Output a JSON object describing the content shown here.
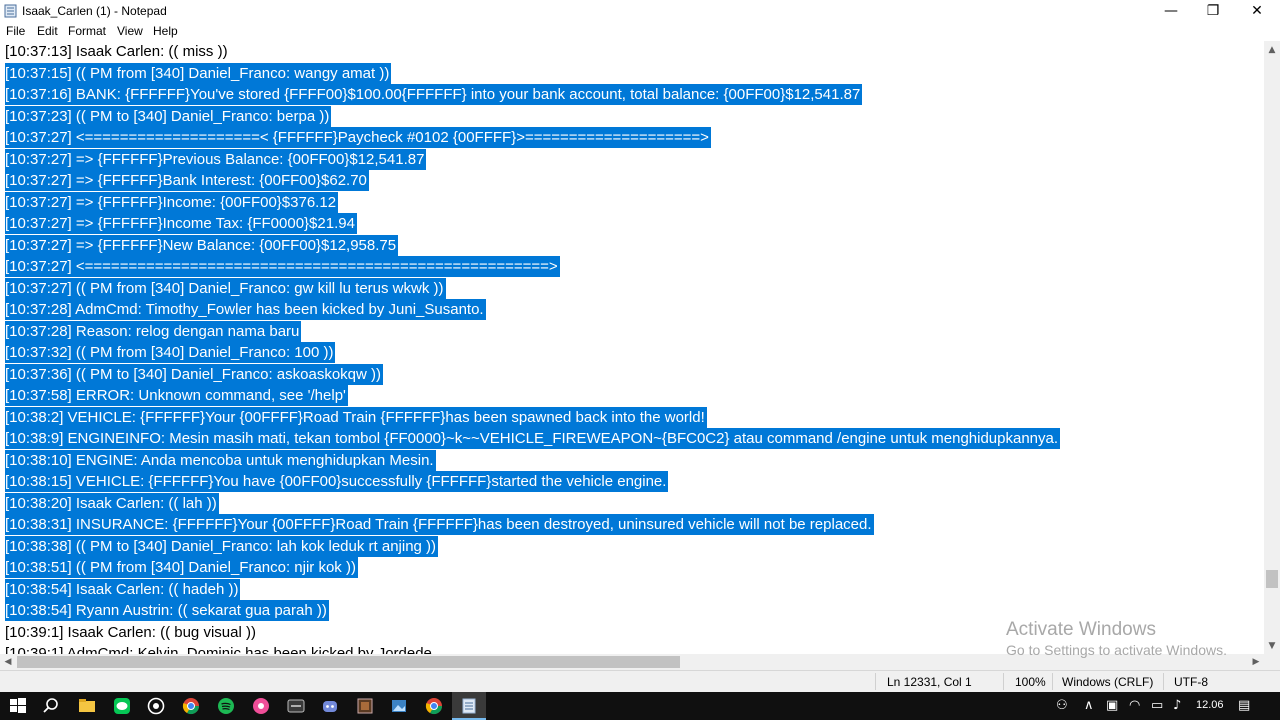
{
  "window": {
    "title": "Isaak_Carlen (1) - Notepad",
    "minimize_glyph": "—",
    "restore_glyph": "❐",
    "close_glyph": "✕"
  },
  "menu": [
    "File",
    "Edit",
    "Format",
    "View",
    "Help"
  ],
  "editor": {
    "lines": [
      {
        "text": "[10:37:13] Isaak Carlen: (( miss ))",
        "selected": false
      },
      {
        "text": "[10:37:15] (( PM from [340] Daniel_Franco: wangy amat ))",
        "selected": true
      },
      {
        "text": "[10:37:16] BANK: {FFFFFF}You've stored {FFFF00}$100.00{FFFFFF} into your bank account, total balance: {00FF00}$12,541.87",
        "selected": true
      },
      {
        "text": "[10:37:23] (( PM to [340] Daniel_Franco: berpa ))",
        "selected": true
      },
      {
        "text": "[10:37:27] <====================< {FFFFFF}Paycheck #0102 {00FFFF}>====================>",
        "selected": true
      },
      {
        "text": "[10:37:27] => {FFFFFF}Previous Balance: {00FF00}$12,541.87",
        "selected": true
      },
      {
        "text": "[10:37:27] => {FFFFFF}Bank Interest: {00FF00}$62.70",
        "selected": true
      },
      {
        "text": "[10:37:27] => {FFFFFF}Income: {00FF00}$376.12",
        "selected": true
      },
      {
        "text": "[10:37:27] => {FFFFFF}Income Tax: {FF0000}$21.94",
        "selected": true
      },
      {
        "text": "[10:37:27] => {FFFFFF}New Balance: {00FF00}$12,958.75",
        "selected": true
      },
      {
        "text": "[10:37:27] <=====================================================>",
        "selected": true
      },
      {
        "text": "[10:37:27] (( PM from [340] Daniel_Franco: gw kill lu terus wkwk ))",
        "selected": true
      },
      {
        "text": "[10:37:28] AdmCmd: Timothy_Fowler has been kicked by Juni_Susanto.",
        "selected": true
      },
      {
        "text": "[10:37:28] Reason: relog dengan nama baru",
        "selected": true
      },
      {
        "text": "[10:37:32] (( PM from [340] Daniel_Franco: 100 ))",
        "selected": true
      },
      {
        "text": "[10:37:36] (( PM to [340] Daniel_Franco: askoaskokqw ))",
        "selected": true
      },
      {
        "text": "[10:37:58] ERROR: Unknown command, see '/help'",
        "selected": true
      },
      {
        "text": "[10:38:2] VEHICLE: {FFFFFF}Your {00FFFF}Road Train {FFFFFF}has been spawned back into the world!",
        "selected": true
      },
      {
        "text": "[10:38:9] ENGINEINFO: Mesin masih mati, tekan tombol {FF0000}~k~~VEHICLE_FIREWEAPON~{BFC0C2} atau command /engine untuk menghidupkannya.",
        "selected": true
      },
      {
        "text": "[10:38:10] ENGINE: Anda mencoba untuk menghidupkan Mesin.",
        "selected": true
      },
      {
        "text": "[10:38:15] VEHICLE: {FFFFFF}You have {00FF00}successfully {FFFFFF}started the vehicle engine.",
        "selected": true
      },
      {
        "text": "[10:38:20] Isaak Carlen: (( lah ))",
        "selected": true
      },
      {
        "text": "[10:38:31] INSURANCE: {FFFFFF}Your {00FFFF}Road Train {FFFFFF}has been destroyed, uninsured vehicle will not be replaced.",
        "selected": true
      },
      {
        "text": "[10:38:38] (( PM to [340] Daniel_Franco: lah kok leduk rt anjing ))",
        "selected": true
      },
      {
        "text": "[10:38:51] (( PM from [340] Daniel_Franco: njir kok ))",
        "selected": true
      },
      {
        "text": "[10:38:54] Isaak Carlen: (( hadeh ))",
        "selected": true
      },
      {
        "text": "[10:38:54] Ryann Austrin: (( sekarat gua parah ))",
        "selected": true
      },
      {
        "text": "[10:39:1] Isaak Carlen: (( bug visual  ))",
        "selected": false
      },
      {
        "text": "[10:39:1] AdmCmd: Kelvin_Dominic has been kicked by Jordede",
        "selected": false
      }
    ]
  },
  "statusbar": {
    "position": "Ln 12331, Col 1",
    "zoom": "100%",
    "line_ending": "Windows (CRLF)",
    "encoding": "UTF-8"
  },
  "watermark": {
    "title": "Activate Windows",
    "subtitle": "Go to Settings to activate Windows."
  },
  "taskbar": {
    "clock": "12.06"
  },
  "colors": {
    "selection": "#0078d7",
    "taskbar": "#101010"
  }
}
